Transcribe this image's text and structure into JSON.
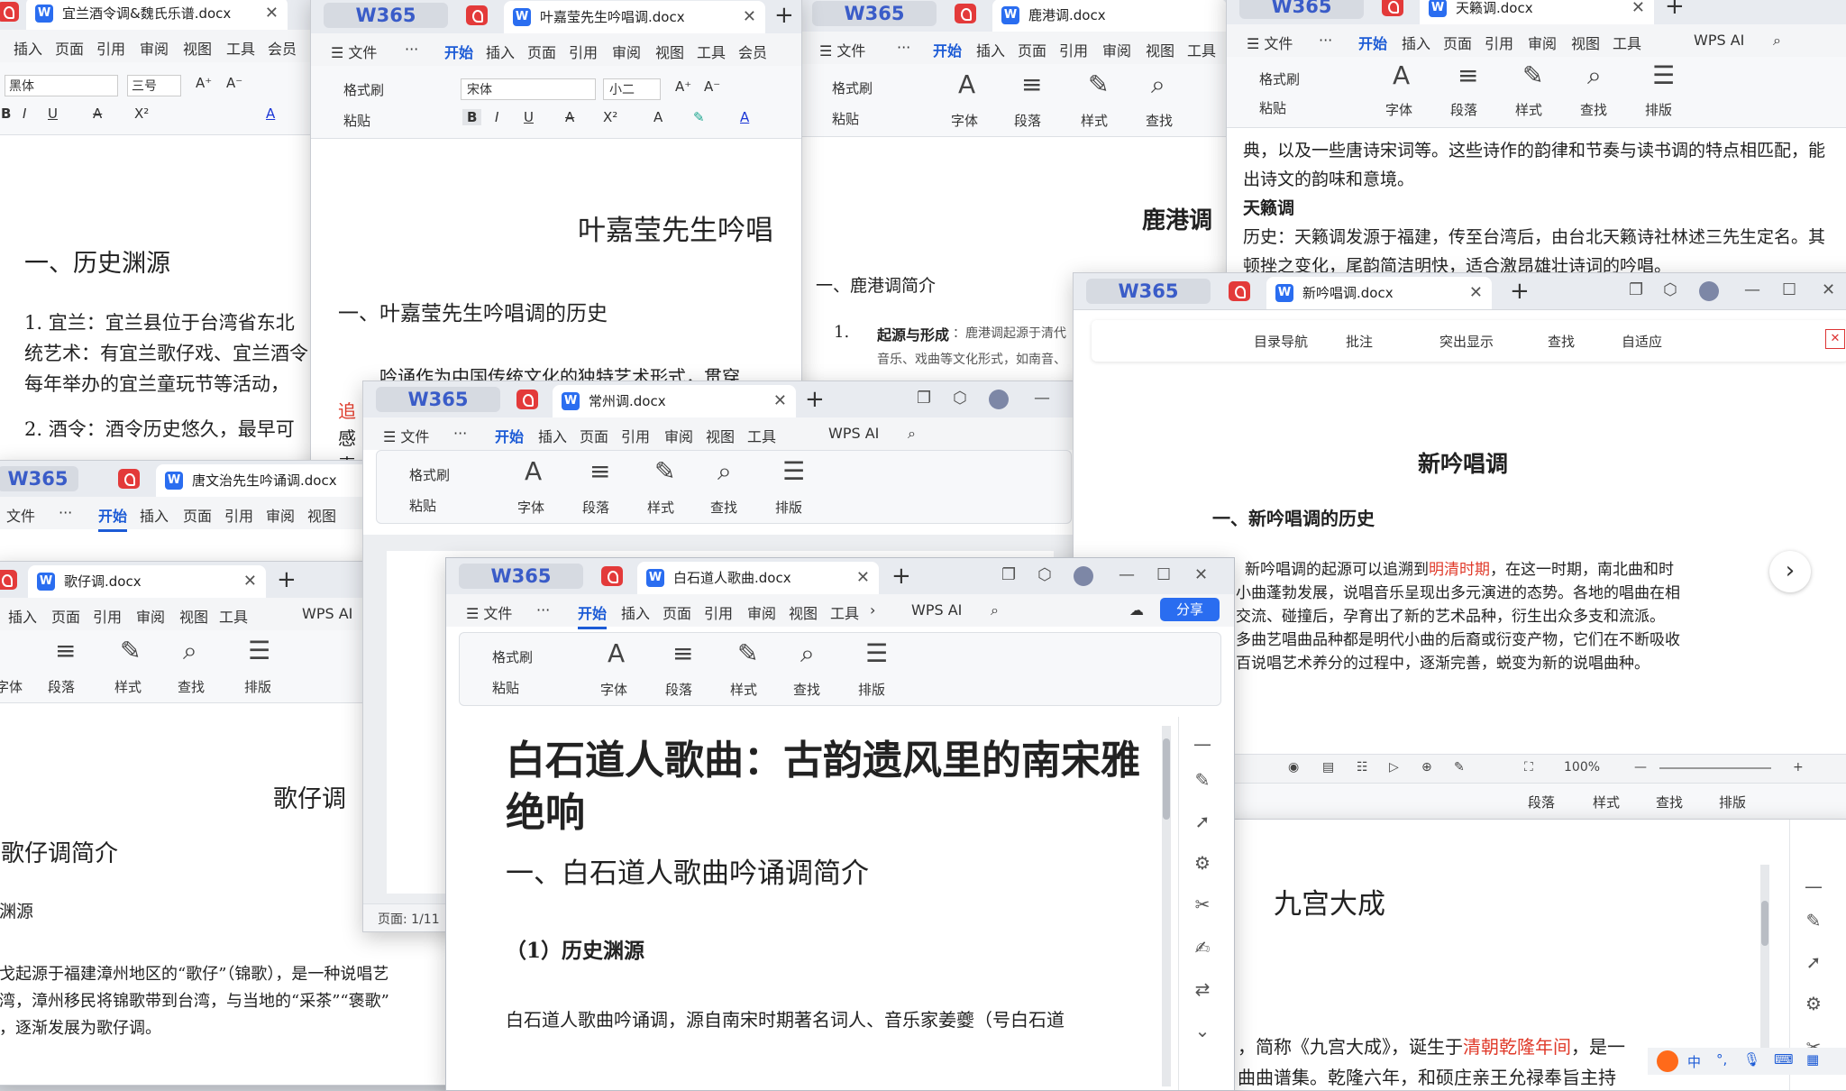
{
  "common": {
    "brand": "W365",
    "doc_icon": "W",
    "close": "✕",
    "plus": "+",
    "menu": {
      "file": "☰ 文件",
      "more": "···",
      "home": "开始",
      "insert": "插入",
      "page": "页面",
      "reference": "引用",
      "review": "审阅",
      "view": "视图",
      "tools": "工具",
      "member": "会员",
      "overflow": "›",
      "wps_ai": "WPS AI"
    },
    "ribbon": {
      "format_painter": "格式刷",
      "paste": "粘贴",
      "font": "字体",
      "paragraph": "段落",
      "style": "样式",
      "find": "查找",
      "layout": "排版"
    }
  },
  "win_yilan": {
    "tab": "宜兰酒令调&魏氏乐谱.docx",
    "font_name": "黑体",
    "font_size": "三号",
    "heading": "一、历史渊源",
    "p1": "1. 宜兰：宜兰县位于台湾省东北",
    "p1b": "统艺术：有宜兰歌仔戏、宜兰酒令",
    "p1c": "每年举办的宜兰童玩节等活动，",
    "p2": "2. 酒令：酒令历史悠久，最早可"
  },
  "win_ye": {
    "tab": "叶嘉莹先生吟唱调.docx",
    "font_name": "宋体",
    "font_size": "小二",
    "title": "叶嘉莹先生吟唱",
    "heading": "一、叶嘉莹先生吟唱调的历史",
    "body": "吟诵作为中国传统文化的独特艺术形式，贯穿",
    "red_fragment": "追",
    "frag2": "感",
    "frag3": "表"
  },
  "win_lugang": {
    "tab": "鹿港调.docx",
    "title": "鹿港调",
    "heading": "一、鹿港调简介",
    "item_num": "1.",
    "item_label": "起源与形成",
    "item_text": "：鹿港调起源于清代",
    "item_line2": "音乐、戏曲等文化形式，如南音、"
  },
  "win_tianlai": {
    "tab": "天籁调.docx",
    "line1": "典，以及一些唐诗宋词等。这些诗作的韵律和节奏与读书调的特点相匹配，能",
    "line2": "出诗文的韵味和意境。",
    "subheading": "天籁调",
    "line3": "历史：天籁调发源于福建，传至台湾后，由台北天籁诗社林述三先生定名。其",
    "line4": "顿挫之变化，尾韵简洁明快，适合激昂雄壮诗词的吟唱。"
  },
  "win_xinyin": {
    "tab": "新吟唱调.docx",
    "toolbar": {
      "toc": "目录导航",
      "comment": "批注",
      "highlight": "突出显示",
      "find": "查找",
      "fit": "自适应"
    },
    "title": "新吟唱调",
    "heading": "一、新吟唱调的历史",
    "p_pre": "新吟唱调的起源可以追溯到",
    "p_red": "明清时期",
    "p_post": "，在这一时期，南北曲和时",
    "line2": "小曲蓬勃发展，说唱音乐呈现出多元演进的态势。各地的唱曲在相",
    "line3": "交流、碰撞后，孕育出了新的艺术品种，衍生出众多支和流派。",
    "line4": "多曲艺唱曲品种都是明代小曲的后裔或衍变产物，它们在不断吸收",
    "line5": "百说唱艺术养分的过程中，逐渐完善，蜕变为新的说唱曲种。",
    "zoom": "100%"
  },
  "win_jiugong": {
    "title": "九宫大成",
    "p_pre": "，简称《九宫大成》，诞生于",
    "p_red": "清朝乾隆年间",
    "p_post": "，是一",
    "line2": "曲曲谱集。乾隆六年，和硕庄亲王允禄奉旨主持"
  },
  "win_changzhou": {
    "tab": "常州调.docx",
    "page_status": "页面: 1/11"
  },
  "win_tang": {
    "tab": "唐文治先生吟诵调.docx"
  },
  "win_gezai": {
    "tab": "歌仔调.docx",
    "title": "歌仔调",
    "heading": "歌仔调简介",
    "sub": "渊源",
    "line1": "戈起源于福建漳州地区的“歌仔”（锦歌），是一种说唱艺",
    "line2": "湾，漳州移民将锦歌带到台湾，与当地的“采茶”“褒歌”",
    "line3": "，逐渐发展为歌仔调。"
  },
  "win_baishi": {
    "tab": "白石道人歌曲.docx",
    "share": "分享",
    "title1": "白石道人歌曲：古韵遗风里的南宋雅",
    "title2": "绝响",
    "heading": "一、白石道人歌曲吟诵调简介",
    "sub": "（1）历史渊源",
    "body": "白石道人歌曲吟诵调，源自南宋时期著名词人、音乐家姜夔（号白石道"
  },
  "taskbar": {
    "ime": "中"
  }
}
